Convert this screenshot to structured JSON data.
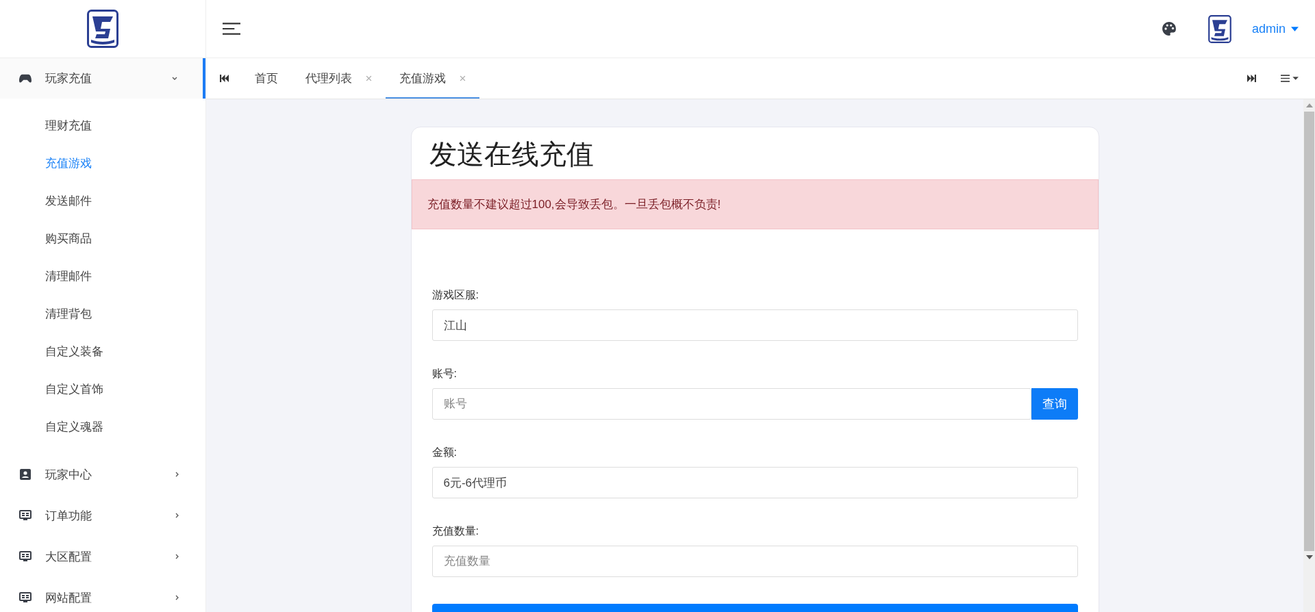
{
  "header": {
    "user": "admin"
  },
  "sidebar": {
    "groups": [
      {
        "label": "玩家充值",
        "expanded": true,
        "selected": true,
        "children": [
          {
            "label": "理财充值",
            "selected": false
          },
          {
            "label": "充值游戏",
            "selected": true
          },
          {
            "label": "发送邮件",
            "selected": false
          },
          {
            "label": "购买商品",
            "selected": false
          },
          {
            "label": "清理邮件",
            "selected": false
          },
          {
            "label": "清理背包",
            "selected": false
          },
          {
            "label": "自定义装备",
            "selected": false
          },
          {
            "label": "自定义首饰",
            "selected": false
          },
          {
            "label": "自定义魂器",
            "selected": false
          }
        ]
      },
      {
        "label": "玩家中心",
        "expanded": false,
        "selected": false
      },
      {
        "label": "订单功能",
        "expanded": false,
        "selected": false
      },
      {
        "label": "大区配置",
        "expanded": false,
        "selected": false
      },
      {
        "label": "网站配置",
        "expanded": false,
        "selected": false
      }
    ]
  },
  "tabs": [
    {
      "label": "首页",
      "closable": false,
      "selected": false
    },
    {
      "label": "代理列表",
      "closable": true,
      "selected": false
    },
    {
      "label": "充值游戏",
      "closable": true,
      "selected": true
    }
  ],
  "form": {
    "title": "发送在线充值",
    "alert": "充值数量不建议超过100,会导致丢包。一旦丢包概不负责!",
    "fields": [
      {
        "label": "游戏区服:",
        "value": "江山"
      },
      {
        "label": "账号:",
        "placeholder": "账号",
        "action": "查询"
      },
      {
        "label": "金额:",
        "value": "6元-6代理币"
      },
      {
        "label": "充值数量:",
        "placeholder": "充值数量"
      }
    ]
  }
}
